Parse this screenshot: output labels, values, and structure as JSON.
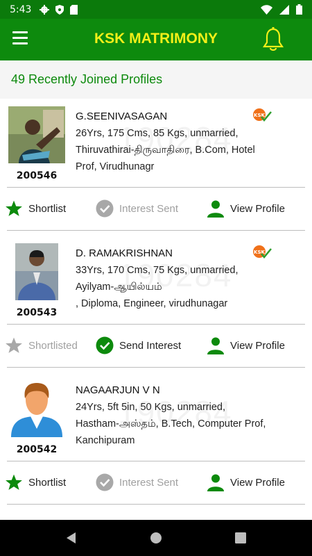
{
  "status_bar": {
    "time": "5:43"
  },
  "app_bar": {
    "title": "KSK MATRIMONY"
  },
  "subheader": {
    "title": "49 Recently Joined Profiles"
  },
  "profiles": [
    {
      "id": "200546",
      "name": "G.SEENIVASAGAN",
      "line1": "26Yrs, 175 Cms, 85 Kgs, unmarried,",
      "line2": "Thiruvathirai-திருவாதிரை, B.Com, Hotel",
      "line3": "Prof, Virudhunagr",
      "watermark": "190284",
      "shortlist_label": "Shortlist",
      "interest_label": "Interest Sent",
      "view_label": "View Profile"
    },
    {
      "id": "200543",
      "name": "D. RAMAKRISHNAN",
      "line1": "33Yrs, 170 Cms, 75 Kgs, unmarried,",
      "line2": "Ayilyam-ஆயில்யம்",
      "line3": ", Diploma, Engineer, virudhunagar",
      "watermark": "190284",
      "shortlist_label": "Shortlisted",
      "interest_label": "Send Interest",
      "view_label": "View Profile"
    },
    {
      "id": "200542",
      "name": "NAGAARJUN V N",
      "line1": "24Yrs, 5ft 5in, 50 Kgs, unmarried,",
      "line2": "Hastham-அஸ்தம், B.Tech, Computer Prof,",
      "line3": "Kanchipuram",
      "watermark": "190284",
      "shortlist_label": "Shortlist",
      "interest_label": "Interest Sent",
      "view_label": "View Profile"
    }
  ],
  "colors": {
    "primary": "#0d8a0d",
    "title": "#f2ef19",
    "disabled": "#a0a0a0",
    "badge": "#f0711a"
  }
}
